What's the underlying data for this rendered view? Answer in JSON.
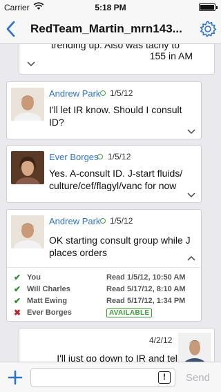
{
  "status_bar": {
    "carrier": "Carrier",
    "time": "5:18 PM"
  },
  "nav": {
    "title": "RedTeam_Martin_mrn143..."
  },
  "partial_message": {
    "lines": [
      "trending up. Also was tachy to",
      "155 in AM"
    ]
  },
  "messages": [
    {
      "author": "Andrew Park",
      "date": "1/5/12",
      "body": "I'll let IR know. Should I consult ID?"
    },
    {
      "author": "Ever Borges",
      "date": "1/5/12",
      "body": "Yes. A-consult ID. J-start fluids/ culture/cef/flagyl/vanc for now"
    },
    {
      "author": "Andrew Park",
      "date": "1/5/12",
      "body": "OK starting consult group while J places orders",
      "receipts": [
        {
          "who": "You",
          "status": "Read 1/5/12, 10:50 AM",
          "mark": "✔"
        },
        {
          "who": "Will Charles",
          "status": "Read 5/17/12, 8:10 AM",
          "mark": "✔"
        },
        {
          "who": "Matt Ewing",
          "status": "Read 5/17/12, 1:34 PM",
          "mark": "✔"
        },
        {
          "who": "Ever Borges",
          "status": "AVAILABLE",
          "mark": "✖"
        }
      ]
    },
    {
      "date": "4/2/12",
      "body": "I'll just go down to IR and tell"
    }
  ],
  "composer": {
    "urgent_label": "!",
    "send_label": "Send"
  },
  "colors": {
    "accent": "#2f73c9",
    "online": "#43a13a",
    "unread": "#b32a2a"
  }
}
